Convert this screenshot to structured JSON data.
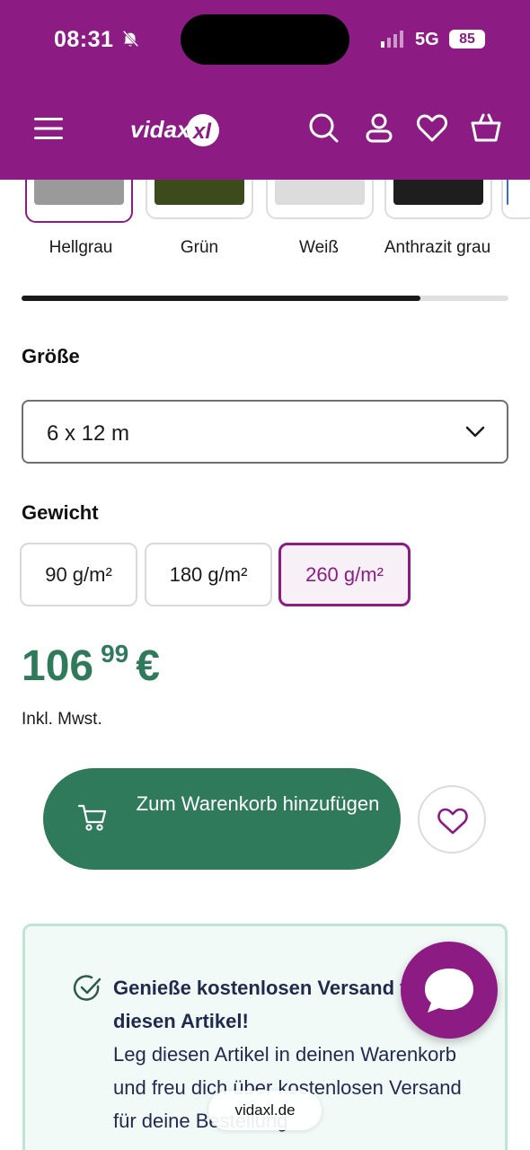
{
  "status_bar": {
    "time": "08:31",
    "network": "5G",
    "battery": "85"
  },
  "header": {
    "brand": "vidaXL",
    "logo_text": "vidaxl"
  },
  "colors_picker": {
    "swatches": [
      {
        "label": "Hellgrau",
        "color": "#9a9a9a",
        "selected": true
      },
      {
        "label": "Grün",
        "color": "#3d4a1c",
        "selected": false
      },
      {
        "label": "Weiß",
        "color": "#dcdcdc",
        "selected": false
      },
      {
        "label": "Anthrazit grau",
        "color": "#1e1e1e",
        "selected": false
      }
    ],
    "scroll_progress": 0.82
  },
  "size": {
    "title": "Größe",
    "selected": "6 x 12 m"
  },
  "weight": {
    "title": "Gewicht",
    "options": [
      "90 g/m²",
      "180 g/m²",
      "260 g/m²"
    ],
    "selected": "260 g/m²"
  },
  "price": {
    "whole": "106",
    "cents": "99",
    "currency": "€",
    "vat_note": "Inkl. Mwst."
  },
  "actions": {
    "add_to_cart": "Zum Warenkorb hinzufügen"
  },
  "promo": {
    "headline": "Genieße kostenlosen Versand für diesen Artikel!",
    "body": "Leg diesen Artikel in deinen Warenkorb und freu dich über kostenlosen Versand für deine Bestellung"
  },
  "browser": {
    "url": "vidaxl.de"
  },
  "theme": {
    "brand": "#8c1c84",
    "price_green": "#2f7a5b",
    "promo_bg": "#f2faf7"
  }
}
